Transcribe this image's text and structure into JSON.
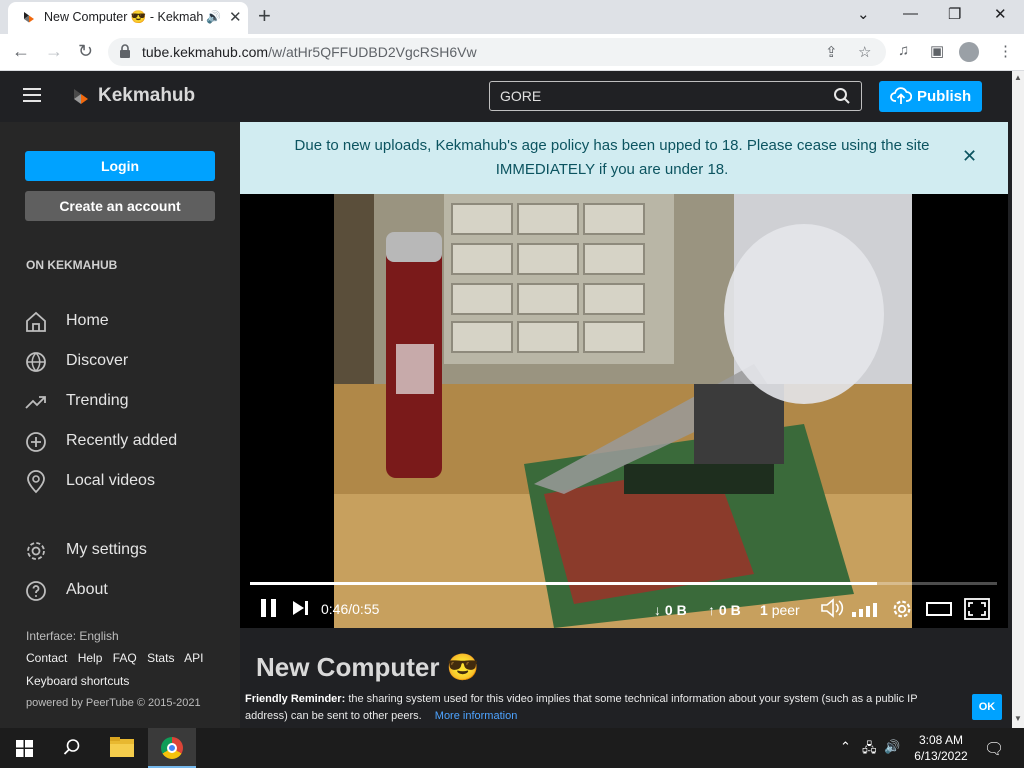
{
  "browser": {
    "tab_title": "New Computer 😎 - Kekmahub",
    "url_host": "tube.kekmahub.com",
    "url_path": "/w/atHr5QFFUDBD2VgcRSH6Vw",
    "window_controls": [
      "⌄",
      "—",
      "❐",
      "✕"
    ]
  },
  "header": {
    "brand": "Kekmahub",
    "search_value": "GORE",
    "publish_label": "Publish"
  },
  "sidebar": {
    "login_label": "Login",
    "create_account_label": "Create an account",
    "section_label": "ON KEKMAHUB",
    "items": [
      {
        "label": "Home",
        "icon": "home-icon"
      },
      {
        "label": "Discover",
        "icon": "globe-icon"
      },
      {
        "label": "Trending",
        "icon": "trending-icon"
      },
      {
        "label": "Recently added",
        "icon": "plus-circle-icon"
      },
      {
        "label": "Local videos",
        "icon": "location-pin-icon"
      },
      {
        "label": "My settings",
        "icon": "gear-icon"
      },
      {
        "label": "About",
        "icon": "question-icon"
      }
    ],
    "interface_label": "Interface: English",
    "footer_links": [
      "Contact",
      "Help",
      "FAQ",
      "Stats",
      "API"
    ],
    "keyboard_shortcuts": "Keyboard shortcuts",
    "powered_by": "powered by PeerTube © 2015-2021"
  },
  "banner": {
    "text": "Due to new uploads, Kekmahub's age policy has been upped to 18. Please cease using the site IMMEDIATELY if you are under 18."
  },
  "player": {
    "time_current": "0:46",
    "time_total": "0:55",
    "progress_fraction": 0.84,
    "download_label": "↓ 0 B",
    "upload_label": "↑ 0 B",
    "peers_count": "1",
    "peers_label": "peer"
  },
  "video": {
    "title": "New Computer 😎"
  },
  "reminder": {
    "title": "Friendly Reminder:",
    "text": "the sharing system used for this video implies that some technical information about your system (such as a public IP address) can be sent to other peers.",
    "link_label": "More information",
    "ok_label": "OK"
  },
  "taskbar": {
    "time": "3:08 AM",
    "date": "6/13/2022"
  },
  "colors": {
    "accent": "#00a2ff",
    "banner_bg": "#d1ecf1",
    "banner_text": "#0c5460",
    "sidebar_bg": "#272727",
    "header_bg": "#202124"
  }
}
